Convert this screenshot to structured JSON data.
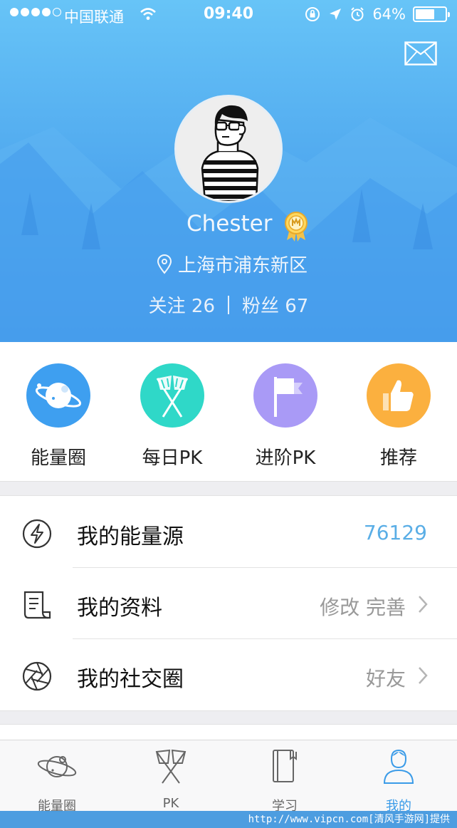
{
  "status_bar": {
    "carrier": "中国联通",
    "time": "09:40",
    "battery": "64%",
    "battery_level": 0.64,
    "signal_icon": "signal-dots-icon",
    "wifi_icon": "wifi-icon"
  },
  "profile": {
    "name": "Chester",
    "location": "上海市浦东新区",
    "following_label": "关注 26",
    "followers_label": "粉丝 67"
  },
  "quick_actions": [
    {
      "label": "能量圈",
      "icon": "planet-icon",
      "color": "#3e9ff0"
    },
    {
      "label": "每日PK",
      "icon": "crossed-flags-icon",
      "color": "#2fd8c8"
    },
    {
      "label": "进阶PK",
      "icon": "flag-icon",
      "color": "#a99af6"
    },
    {
      "label": "推荐",
      "icon": "thumbs-up-icon",
      "color": "#fbb03f"
    }
  ],
  "menu": [
    {
      "label": "我的能量源",
      "value": "76129",
      "icon": "lightning-icon"
    },
    {
      "label": "我的资料",
      "value": "修改 完善",
      "icon": "document-icon"
    },
    {
      "label": "我的社交圈",
      "value": "好友",
      "icon": "aperture-icon"
    }
  ],
  "tabs": [
    {
      "label": "能量圈",
      "icon": "planet-icon",
      "active": false
    },
    {
      "label": "PK",
      "icon": "crossed-flags-icon",
      "active": false
    },
    {
      "label": "学习",
      "icon": "notebook-icon",
      "active": false
    },
    {
      "label": "我的",
      "icon": "person-icon",
      "active": true
    }
  ],
  "watermark": "http://www.vipcn.com[清风手游网]提供",
  "colors": {
    "header_top": "#67c4f7",
    "header_bottom": "#3a8de6",
    "accent": "#3a9be8",
    "value_blue": "#5aaee6"
  }
}
